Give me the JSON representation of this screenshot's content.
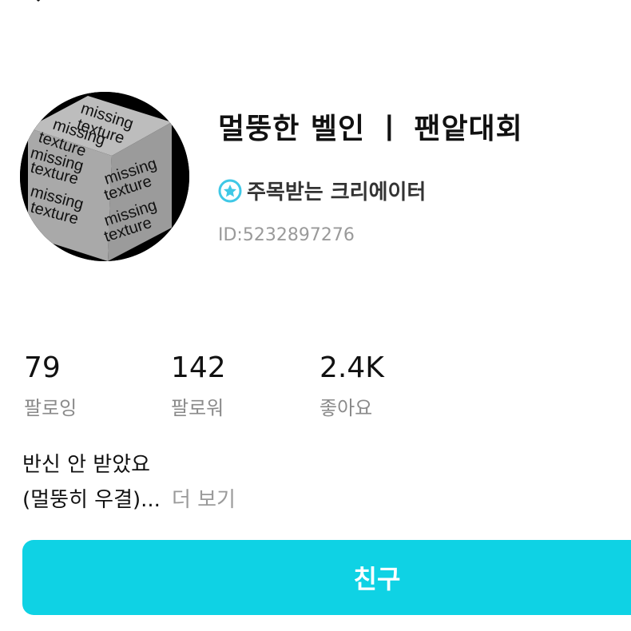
{
  "profile": {
    "name": "멀뚱한 벨인 ㅣ 팬앝대회",
    "badge": "주목받는 크리에이터",
    "user_id": "ID:5232897276",
    "avatar_words": [
      "missing",
      "texture"
    ]
  },
  "stats": [
    {
      "value": "79",
      "label": "팔로잉"
    },
    {
      "value": "142",
      "label": "팔로워"
    },
    {
      "value": "2.4K",
      "label": "좋아요"
    }
  ],
  "bio": {
    "line1": "반신 안 받았요",
    "line2": "(멀뚱히 우결)...",
    "more": "더 보기"
  },
  "actions": {
    "friend_label": "친구"
  },
  "colors": {
    "accent": "#0fd2e4",
    "badge": "#3fc8e6",
    "muted": "#9a9a9a"
  }
}
